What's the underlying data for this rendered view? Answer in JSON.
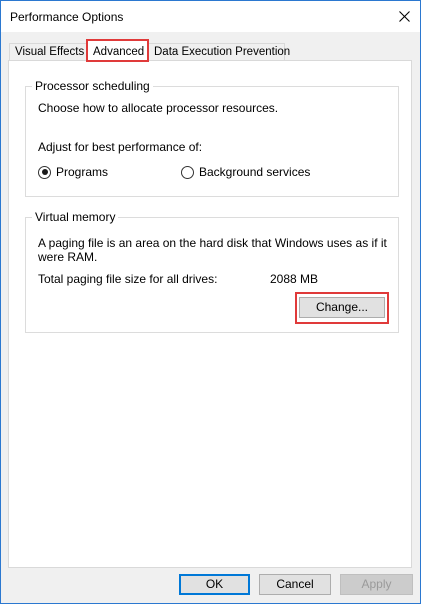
{
  "window": {
    "title": "Performance Options"
  },
  "tabs": [
    {
      "label": "Visual Effects",
      "active": false
    },
    {
      "label": "Advanced",
      "active": true
    },
    {
      "label": "Data Execution Prevention",
      "active": false
    }
  ],
  "processor_scheduling": {
    "title": "Processor scheduling",
    "description": "Choose how to allocate processor resources.",
    "adjust_label": "Adjust for best performance of:",
    "options": [
      {
        "label": "Programs",
        "checked": true
      },
      {
        "label": "Background services",
        "checked": false
      }
    ]
  },
  "virtual_memory": {
    "title": "Virtual memory",
    "description_line1": "A paging file is an area on the hard disk that Windows uses as if it",
    "description_line2": "were RAM.",
    "total_label": "Total paging file size for all drives:",
    "total_value": "2088 MB",
    "change_label": "Change..."
  },
  "footer": {
    "ok_label": "OK",
    "cancel_label": "Cancel",
    "apply_label": "Apply"
  },
  "colors": {
    "highlight": "#e03a3a",
    "window_border": "#2b78d0",
    "ok_border": "#0078d7"
  }
}
